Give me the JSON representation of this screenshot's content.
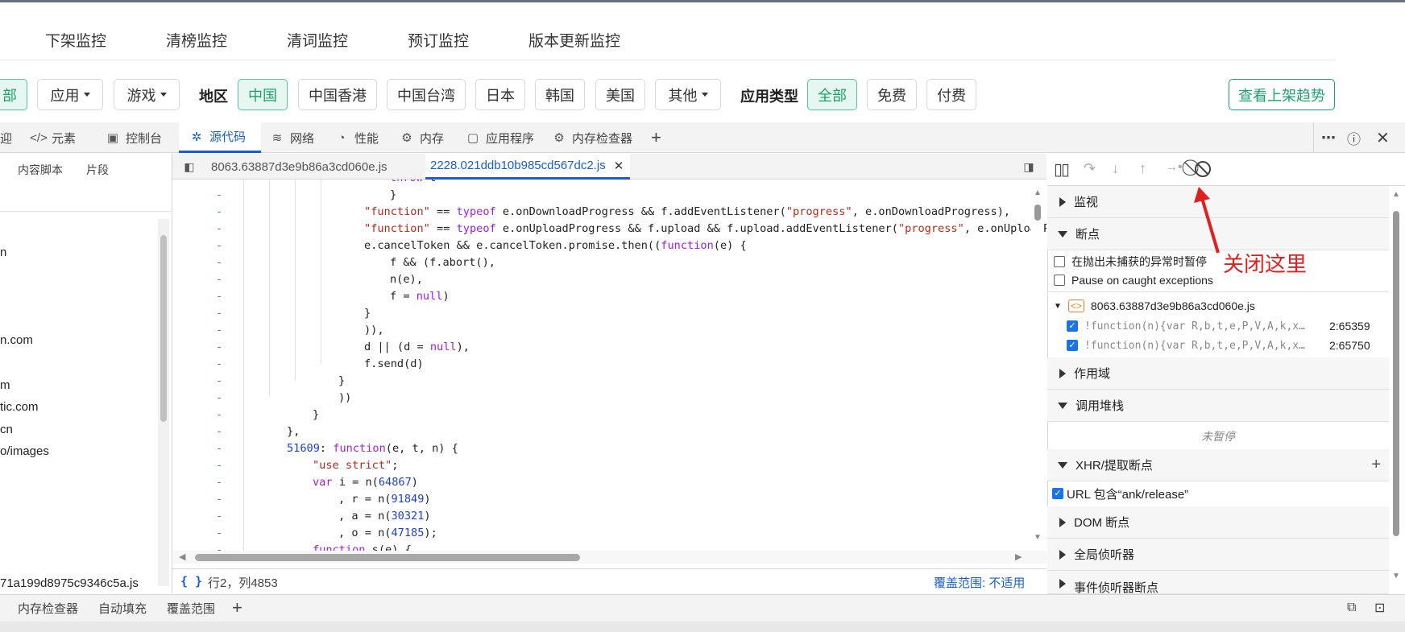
{
  "page": {
    "nav_tabs": [
      "下架监控",
      "清榜监控",
      "清词监控",
      "预订监控",
      "版本更新监控"
    ],
    "filter": {
      "partial_all": "部",
      "app": "应用",
      "game": "游戏",
      "region_label": "地区",
      "regions": [
        "中国",
        "中国香港",
        "中国台湾",
        "日本",
        "韩国",
        "美国"
      ],
      "other": "其他",
      "apptype_label": "应用类型",
      "apptypes": [
        "全部",
        "免费",
        "付费"
      ],
      "trend_button": "查看上架趋势"
    }
  },
  "devtools": {
    "tabs": [
      "迎",
      "元素",
      "控制台",
      "源代码",
      "网络",
      "性能",
      "内存",
      "应用程序",
      "内存检查器"
    ],
    "active_tab": "源代码",
    "navigator": {
      "subtabs": [
        "内容脚本",
        "片段"
      ],
      "items": [
        "n",
        "n.com",
        "m",
        "tic.com",
        "cn",
        "o/images",
        "71a199d8975c9346c5a.js"
      ]
    },
    "editor": {
      "tabs": [
        "8063.63887d3e9b86a3cd060e.js",
        "2228.021ddb10b985cd567dc2.js"
      ],
      "active_tab": "2228.021ddb10b985cd567dc2.js",
      "lines": [
        {
          "gutter": "-",
          "indent": 10,
          "html": "<span class='kw'>throw</span> t"
        },
        {
          "gutter": "-",
          "indent": 10,
          "html": "}"
        },
        {
          "gutter": "-",
          "indent": 8,
          "html": "<span class='str'>\"function\"</span> == <span class='kw'>typeof</span> e.onDownloadProgress && f.addEventListener(<span class='str'>\"progress\"</span>, e.onDownloadProgress),"
        },
        {
          "gutter": "-",
          "indent": 8,
          "html": "<span class='str'>\"function\"</span> == <span class='kw'>typeof</span> e.onUploadProgress && f.upload && f.upload.addEventListener(<span class='str'>\"progress\"</span>, e.onUploadProgress),"
        },
        {
          "gutter": "-",
          "indent": 8,
          "html": "e.cancelToken && e.cancelToken.promise.then((<span class='kw'>function</span>(e) {"
        },
        {
          "gutter": "-",
          "indent": 10,
          "html": "f && (f.abort(),"
        },
        {
          "gutter": "-",
          "indent": 10,
          "html": "n(e),"
        },
        {
          "gutter": "-",
          "indent": 10,
          "html": "f = <span class='kw'>null</span>)"
        },
        {
          "gutter": "-",
          "indent": 8,
          "html": "}"
        },
        {
          "gutter": "-",
          "indent": 8,
          "html": ")),"
        },
        {
          "gutter": "-",
          "indent": 8,
          "html": "d || (d = <span class='kw'>null</span>),"
        },
        {
          "gutter": "-",
          "indent": 8,
          "html": "f.send(d)"
        },
        {
          "gutter": "-",
          "indent": 6,
          "html": "}"
        },
        {
          "gutter": "-",
          "indent": 6,
          "html": "))"
        },
        {
          "gutter": "-",
          "indent": 4,
          "html": "}"
        },
        {
          "gutter": "-",
          "indent": 2,
          "html": "},"
        },
        {
          "gutter": "-",
          "indent": 2,
          "html": "<span class='num'>51609</span>: <span class='kw'>function</span>(e, t, n) {"
        },
        {
          "gutter": "-",
          "indent": 4,
          "html": "<span class='str'>\"use strict\"</span>;"
        },
        {
          "gutter": "-",
          "indent": 4,
          "html": "<span class='kw'>var</span> i = n(<span class='num'>64867</span>)"
        },
        {
          "gutter": "-",
          "indent": 6,
          "html": ", r = n(<span class='num'>91849</span>)"
        },
        {
          "gutter": "-",
          "indent": 6,
          "html": ", a = n(<span class='num'>30321</span>)"
        },
        {
          "gutter": "-",
          "indent": 6,
          "html": ", o = n(<span class='num'>47185</span>);"
        },
        {
          "gutter": "-",
          "indent": 4,
          "html": "<span class='kw'>function</span> s(e) {"
        }
      ],
      "status_position": "行2，列4853",
      "coverage": "覆盖范围: 不适用",
      "format_icon": "{ }"
    },
    "debugger": {
      "sections": {
        "watch": "监视",
        "breakpoints": "断点",
        "pause_uncaught": "在抛出未捕获的异常时暂停",
        "pause_caught": "Pause on caught exceptions",
        "bp_file": "8063.63887d3e9b86a3cd060e.js",
        "bp_items": [
          {
            "code": "!function(n){var R,b,t,e,P,V,A,k,x…",
            "loc": "2:65359"
          },
          {
            "code": "!function(n){var R,b,t,e,P,V,A,k,x…",
            "loc": "2:65750"
          }
        ],
        "scope": "作用域",
        "callstack": "调用堆栈",
        "not_paused": "未暂停",
        "xhr": "XHR/提取断点",
        "xhr_item": "URL 包含“ank/release”",
        "dom": "DOM 断点",
        "global": "全局侦听器",
        "event": "事件侦听器断点"
      },
      "annotation": "关闭这里"
    },
    "drawer_tabs": [
      "内存检查器",
      "自动填充",
      "覆盖范围"
    ]
  }
}
